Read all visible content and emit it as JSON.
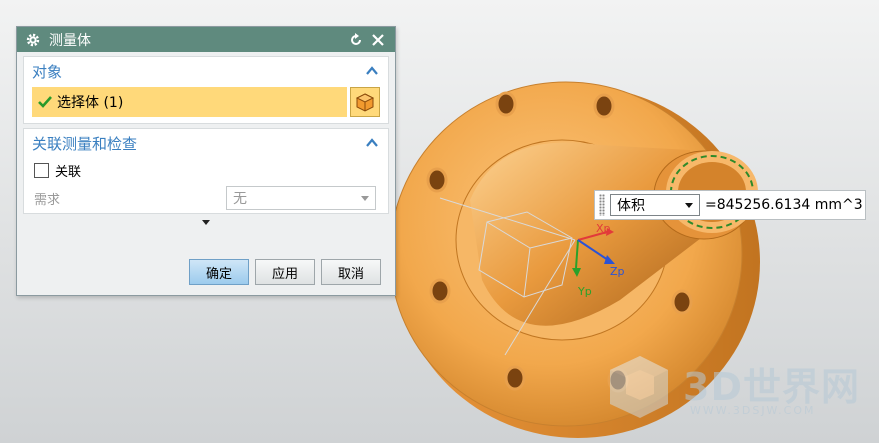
{
  "dialog": {
    "title": "测量体",
    "sections": {
      "object": {
        "title": "对象",
        "select_label": "选择体 (1)"
      },
      "assoc": {
        "title": "关联测量和检查",
        "checkbox_label": "关联",
        "checked": false,
        "require_label": "需求",
        "require_value": "无"
      }
    },
    "buttons": {
      "ok": "确定",
      "apply": "应用",
      "cancel": "取消"
    }
  },
  "measurement": {
    "type": "体积",
    "value": "=845256.6134 mm^3"
  },
  "axes": {
    "x_label": "Xp",
    "y_label": "Yp",
    "z_label": "Zp"
  },
  "watermark": {
    "brand": "3D世界网",
    "url": "WWW.3DSJW.COM"
  },
  "colors": {
    "title_bar": "#5f8a7e",
    "section_header": "#3a7fc0",
    "selection": "#ffd97a",
    "part": "#f2a84c"
  }
}
